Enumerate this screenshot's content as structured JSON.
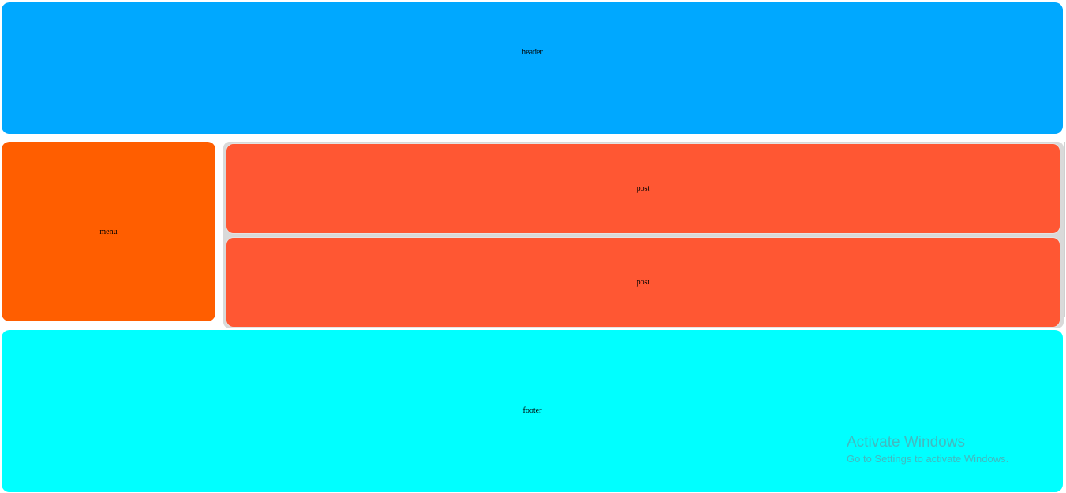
{
  "header": {
    "label": "header"
  },
  "menu": {
    "label": "menu"
  },
  "posts": [
    {
      "label": "post"
    },
    {
      "label": "post"
    }
  ],
  "footer": {
    "label": "footer"
  },
  "watermark": {
    "title": "Activate Windows",
    "subtitle": "Go to Settings to activate Windows."
  },
  "colors": {
    "header": "#00a8ff",
    "menu": "#ff5e00",
    "post": "#ff5733",
    "footer": "#00ffff"
  }
}
